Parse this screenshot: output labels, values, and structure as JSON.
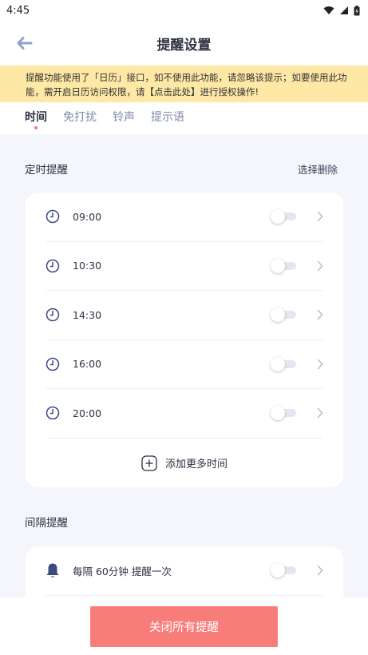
{
  "status_bar": {
    "time": "4:45"
  },
  "header": {
    "title": "提醒设置"
  },
  "notice": {
    "text_before": "提醒功能使用了「日历」接口，如不使用此功能，请忽略该提示；如要使用此功能，需开启日历访问权限，请",
    "link": "【点击此处】",
    "text_after": "进行授权操作!"
  },
  "tabs": [
    {
      "label": "时间",
      "active": true
    },
    {
      "label": "免打扰",
      "active": false
    },
    {
      "label": "铃声",
      "active": false
    },
    {
      "label": "提示语",
      "active": false
    }
  ],
  "timed": {
    "title": "定时提醒",
    "action": "选择删除",
    "items": [
      {
        "time": "09:00",
        "enabled": false
      },
      {
        "time": "10:30",
        "enabled": false
      },
      {
        "time": "14:30",
        "enabled": false
      },
      {
        "time": "16:00",
        "enabled": false
      },
      {
        "time": "20:00",
        "enabled": false
      }
    ],
    "add_label": "添加更多时间"
  },
  "interval": {
    "title": "间隔提醒",
    "items": [
      {
        "label": "每隔 60分钟 提醒一次",
        "enabled": false
      }
    ]
  },
  "bottom": {
    "close_all_label": "关闭所有提醒"
  },
  "colors": {
    "accent": "#f87c79",
    "notice_bg": "#fde8a6",
    "icon": "#3c4a80",
    "page_bg": "#f5f6fb"
  }
}
